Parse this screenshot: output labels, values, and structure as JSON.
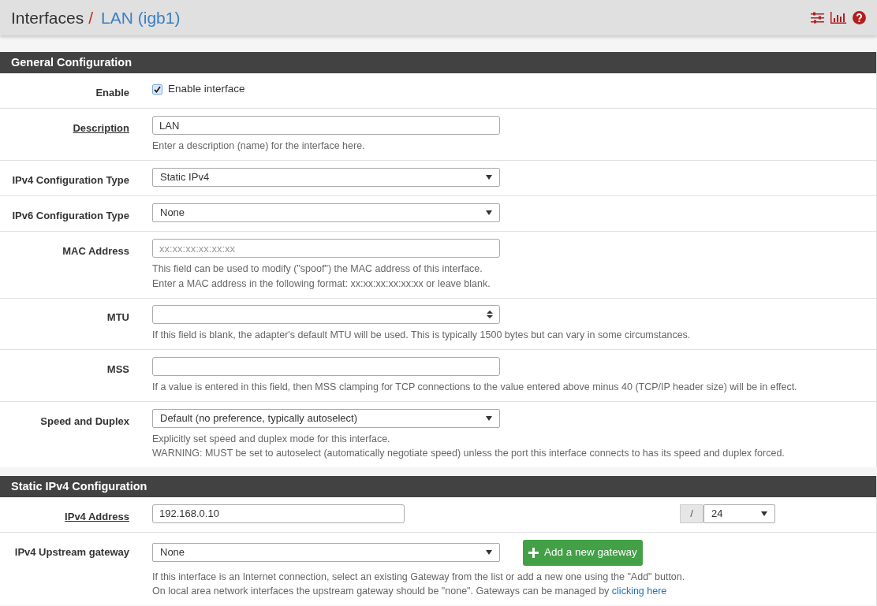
{
  "breadcrumb": {
    "section": "Interfaces",
    "separator": "/",
    "current": "LAN (igb1)"
  },
  "sections": [
    {
      "title": "General Configuration",
      "rows": [
        {
          "kind": "checkbox",
          "label": "Enable",
          "required": false,
          "checked": true,
          "text": "Enable interface"
        },
        {
          "kind": "text",
          "label": "Description",
          "required": true,
          "value": "LAN",
          "help": [
            {
              "text": "Enter a description (name) for the interface here."
            }
          ]
        },
        {
          "kind": "select",
          "label": "IPv4 Configuration Type",
          "required": false,
          "value": "Static IPv4"
        },
        {
          "kind": "select",
          "label": "IPv6 Configuration Type",
          "required": false,
          "value": "None"
        },
        {
          "kind": "text",
          "label": "MAC Address",
          "required": false,
          "placeholder": "xx:xx:xx:xx:xx:xx",
          "help": [
            {
              "text": "This field can be used to modify (\"spoof\") the MAC address of this interface."
            },
            {
              "text": "Enter a MAC address in the following format: xx:xx:xx:xx:xx:xx or leave blank."
            }
          ]
        },
        {
          "kind": "number",
          "label": "MTU",
          "required": false,
          "help": [
            {
              "text": "If this field is blank, the adapter's default MTU will be used. This is typically 1500 bytes but can vary in some circumstances."
            }
          ]
        },
        {
          "kind": "text",
          "label": "MSS",
          "required": false,
          "help": [
            {
              "text": "If a value is entered in this field, then MSS clamping for TCP connections to the value entered above minus 40 (TCP/IP header size) will be in effect."
            }
          ]
        },
        {
          "kind": "select",
          "label": "Speed and Duplex",
          "required": false,
          "value": "Default (no preference, typically autoselect)",
          "help": [
            {
              "text": "Explicitly set speed and duplex mode for this interface."
            },
            {
              "text": "WARNING: MUST be set to autoselect (automatically negotiate speed) unless the port this interface connects to has its speed and duplex forced."
            }
          ]
        }
      ]
    },
    {
      "title": "Static IPv4 Configuration",
      "rows": [
        {
          "kind": "address",
          "label": "IPv4 Address",
          "required": true,
          "value": "192.168.0.10",
          "addon": "/",
          "mask": "24"
        },
        {
          "kind": "gateway",
          "label": "IPv4 Upstream gateway",
          "required": false,
          "value": "None",
          "button": "Add a new gateway",
          "help": [
            {
              "text": "If this interface is an Internet connection, select an existing Gateway from the list or add a new one using the \"Add\" button."
            },
            {
              "text": "On local area network interfaces the upstream gateway should be \"none\". Gateways can be managed by ",
              "link": "clicking here"
            }
          ]
        }
      ]
    }
  ]
}
